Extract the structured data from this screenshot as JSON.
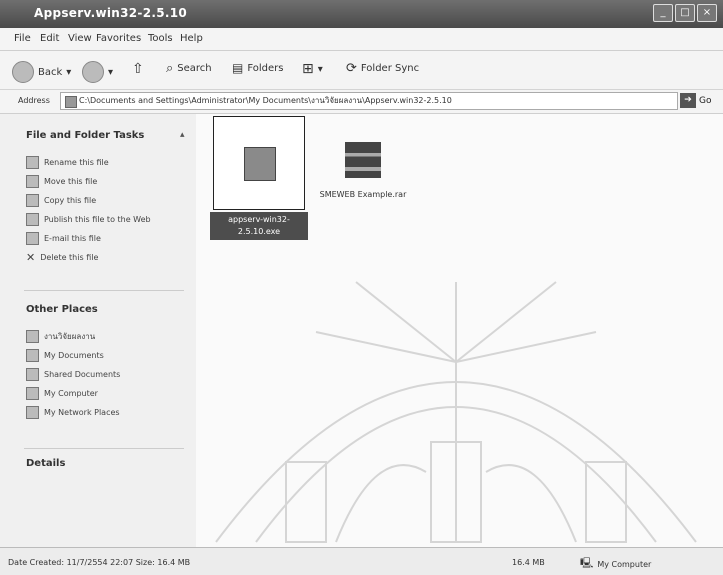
{
  "window": {
    "title": "Appserv.win32-2.5.10"
  },
  "menu": [
    "File",
    "Edit",
    "View",
    "Favorites",
    "Tools",
    "Help"
  ],
  "toolbar": {
    "back": "Back",
    "search": "Search",
    "folders": "Folders",
    "folder_sync": "Folder Sync"
  },
  "address": {
    "label": "Address",
    "path": "C:\\Documents and Settings\\Administrator\\My Documents\\งานวิจัยผลงาน\\Appserv.win32-2.5.10",
    "go": "Go"
  },
  "sidebar": {
    "tasks_title": "File and Folder Tasks",
    "tasks": [
      "Rename this file",
      "Move this file",
      "Copy this file",
      "Publish this file to the Web",
      "E-mail this file",
      "Delete this file"
    ],
    "places_title": "Other Places",
    "places": [
      "งานวิจัยผลงาน",
      "My Documents",
      "Shared Documents",
      "My Computer",
      "My Network Places"
    ],
    "details_title": "Details"
  },
  "files": [
    {
      "name": "appserv-win32-2.5.10.exe",
      "selected": true,
      "icon": "installer-icon"
    },
    {
      "name": "SMEWEB Example.rar",
      "selected": false,
      "icon": "rar-archive-icon"
    }
  ],
  "status": {
    "text": "Date Created: 11/7/2554 22:07 Size: 16.4 MB",
    "size": "16.4 MB",
    "zone": "My Computer"
  }
}
